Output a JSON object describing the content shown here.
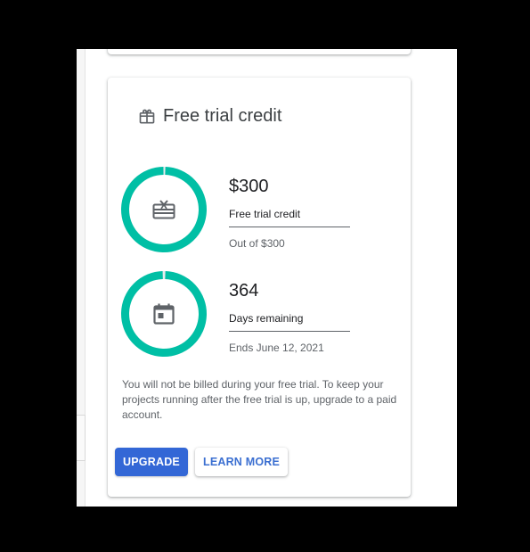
{
  "colors": {
    "accent_ring": "#00bfa5",
    "primary_button": "#3367d6",
    "link_blue": "#3b6fd1",
    "icon_gray": "#5f6368"
  },
  "card": {
    "title": "Free trial credit",
    "title_icon": "gift-icon"
  },
  "credit": {
    "value": "$300",
    "label": "Free trial credit",
    "sub": "Out of $300",
    "icon": "gift-card-icon",
    "ring_fraction": 1.0
  },
  "days": {
    "value": "364",
    "label": "Days remaining",
    "sub": "Ends June 12, 2021",
    "icon": "calendar-icon",
    "ring_fraction": 0.997
  },
  "description": "You will not be billed during your free trial. To keep your projects running after the free trial is up, upgrade to a paid account.",
  "buttons": {
    "upgrade": "UPGRADE",
    "learn_more": "LEARN MORE"
  }
}
